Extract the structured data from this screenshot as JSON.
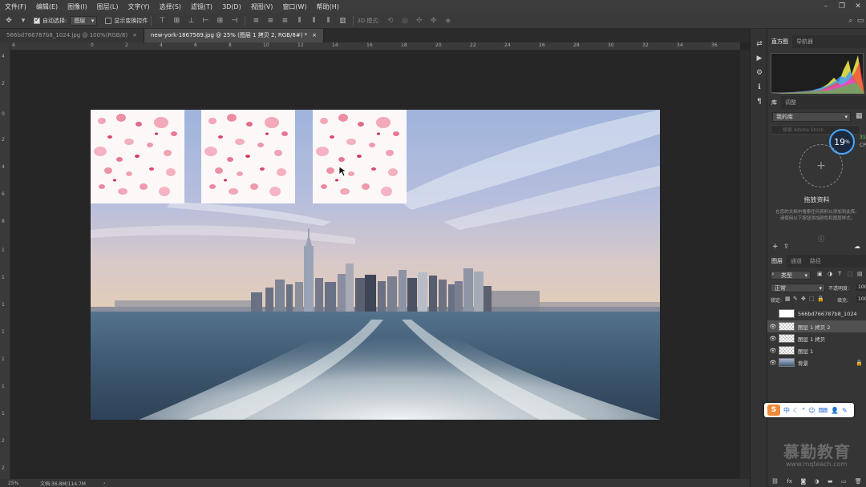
{
  "menu": [
    "文件(F)",
    "编辑(E)",
    "图像(I)",
    "图层(L)",
    "文字(Y)",
    "选择(S)",
    "滤镜(T)",
    "3D(D)",
    "视图(V)",
    "窗口(W)",
    "帮助(H)"
  ],
  "options": {
    "auto_select_label": "自动选择:",
    "auto_select_value": "图层",
    "show_transform_label": "显示变换控件",
    "mode_3d_label": "3D 模式:"
  },
  "tabs": [
    {
      "label": "566bd766787b8_1024.jpg @ 100%(RGB/8)",
      "close": "×"
    },
    {
      "label": "new-york-1867569.jpg @ 25% (图层 1 拷贝 2, RGB/8#) *",
      "close": "×"
    }
  ],
  "ruler_top": [
    "4",
    "0",
    "2",
    "4",
    "6",
    "8",
    "10",
    "12",
    "14",
    "16",
    "18",
    "20",
    "22",
    "24",
    "26",
    "28",
    "30",
    "32",
    "34",
    "36"
  ],
  "ruler_left": [
    "4",
    "2",
    "0",
    "2",
    "4",
    "6",
    "8",
    "1",
    "1",
    "1",
    "1",
    "1",
    "1",
    "1",
    "2",
    "2"
  ],
  "status": {
    "zoom": "25%",
    "doc": "文档:36.8M/114.7M"
  },
  "panels": {
    "histogram_tabs": [
      "直方图",
      "导航器"
    ],
    "library_tabs": [
      "库",
      "调整"
    ],
    "library_select": "我的库",
    "library_search_placeholder": "搜索 Adobe Stock",
    "library_drop_title": "拖放资料",
    "library_drop_desc": "在您的文档中搜索任何资料以添加到此库。请使用以下按钮添加颜色和图层样式。",
    "cpu_percent": "19",
    "cpu_unit": "%",
    "cpu_side_top": "31",
    "cpu_side_bottom": "CP",
    "layers_tabs": [
      "图层",
      "通道",
      "路径"
    ],
    "kind_label": "类型",
    "blend_mode": "正常",
    "opacity_label": "不透明度:",
    "opacity_value": "100",
    "lock_label": "锁定:",
    "fill_label": "填充:",
    "fill_value": "100"
  },
  "layers": [
    {
      "name": "566bd766787b8_1024",
      "visible": false
    },
    {
      "name": "图层 1 拷贝 2",
      "visible": true
    },
    {
      "name": "图层 1 拷贝",
      "visible": true
    },
    {
      "name": "图层 1",
      "visible": true
    },
    {
      "name": "背景",
      "visible": true
    }
  ],
  "ime": {
    "label": "中"
  },
  "watermark": {
    "cn": "慕勤教育",
    "url": "www.mqteach.com"
  }
}
